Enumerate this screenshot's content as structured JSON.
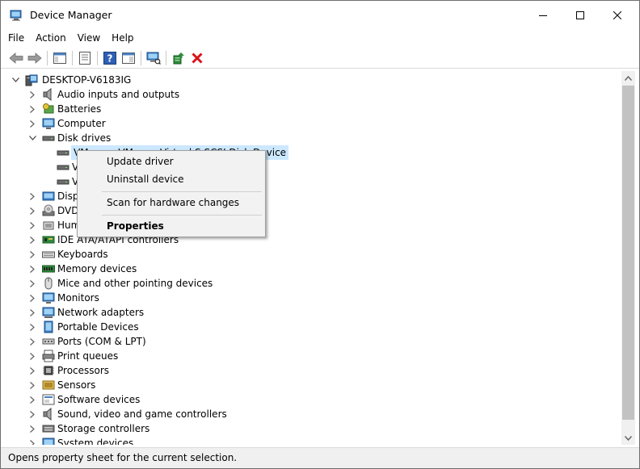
{
  "window": {
    "title": "Device Manager",
    "icon": "device-manager-icon",
    "controls": [
      "minimize-icon",
      "maximize-icon",
      "close-icon"
    ]
  },
  "menu": {
    "items": [
      {
        "label": "File"
      },
      {
        "label": "Action"
      },
      {
        "label": "View"
      },
      {
        "label": "Help"
      }
    ]
  },
  "toolbar": {
    "buttons": [
      "back-arrow-icon",
      "forward-arrow-icon",
      "show-hide-console-tree-icon",
      "properties-sheet-icon",
      "help-icon",
      "action-pane-icon",
      "scan-hardware-changes-icon",
      "update-driver-icon",
      "uninstall-device-icon"
    ]
  },
  "tree": {
    "root": {
      "label": "DESKTOP-V6183IG",
      "icon": "computer-root-icon",
      "expanded": true
    },
    "categories": [
      {
        "label": "Audio inputs and outputs",
        "icon": "speaker-icon",
        "expanded": false
      },
      {
        "label": "Batteries",
        "icon": "battery-icon",
        "expanded": false
      },
      {
        "label": "Computer",
        "icon": "monitor-icon",
        "expanded": false
      },
      {
        "label": "Disk drives",
        "icon": "disk-drive-icon",
        "expanded": true,
        "children": [
          {
            "label": "VMware, VMware Virtual S SCSI Disk Device",
            "icon": "disk-drive-icon",
            "selected": true
          },
          {
            "label": "V",
            "icon": "disk-drive-icon"
          },
          {
            "label": "V",
            "icon": "disk-drive-icon"
          }
        ]
      },
      {
        "label": "Disp",
        "icon": "display-adapter-icon",
        "expanded": false
      },
      {
        "label": "DVD,",
        "icon": "dvd-icon",
        "expanded": false
      },
      {
        "label": "Hum",
        "icon": "hid-icon",
        "expanded": false
      },
      {
        "label": "IDE ATA/ATAPI controllers",
        "icon": "ide-controller-icon",
        "expanded": false
      },
      {
        "label": "Keyboards",
        "icon": "keyboard-icon",
        "expanded": false
      },
      {
        "label": "Memory devices",
        "icon": "memory-icon",
        "expanded": false
      },
      {
        "label": "Mice and other pointing devices",
        "icon": "mouse-icon",
        "expanded": false
      },
      {
        "label": "Monitors",
        "icon": "monitor-icon",
        "expanded": false
      },
      {
        "label": "Network adapters",
        "icon": "network-adapter-icon",
        "expanded": false
      },
      {
        "label": "Portable Devices",
        "icon": "portable-device-icon",
        "expanded": false
      },
      {
        "label": "Ports (COM & LPT)",
        "icon": "port-icon",
        "expanded": false
      },
      {
        "label": "Print queues",
        "icon": "printer-icon",
        "expanded": false
      },
      {
        "label": "Processors",
        "icon": "processor-icon",
        "expanded": false
      },
      {
        "label": "Sensors",
        "icon": "sensor-icon",
        "expanded": false
      },
      {
        "label": "Software devices",
        "icon": "software-device-icon",
        "expanded": false
      },
      {
        "label": "Sound, video and game controllers",
        "icon": "speaker-icon",
        "expanded": false
      },
      {
        "label": "Storage controllers",
        "icon": "storage-controller-icon",
        "expanded": false
      },
      {
        "label": "System devices",
        "icon": "system-device-icon",
        "expanded": false
      }
    ]
  },
  "context_menu": {
    "items": [
      {
        "label": "Update driver",
        "bold": false
      },
      {
        "label": "Uninstall device",
        "bold": false
      },
      {
        "label": "Scan for hardware changes",
        "bold": false
      },
      {
        "label": "Properties",
        "bold": true
      }
    ]
  },
  "status": {
    "text": "Opens property sheet for the current selection."
  },
  "colors": {
    "selection": "#cce8ff",
    "menu_background": "#f2f2f2",
    "status_background": "#f0f0f0",
    "uninstall_red": "#d9141b"
  }
}
